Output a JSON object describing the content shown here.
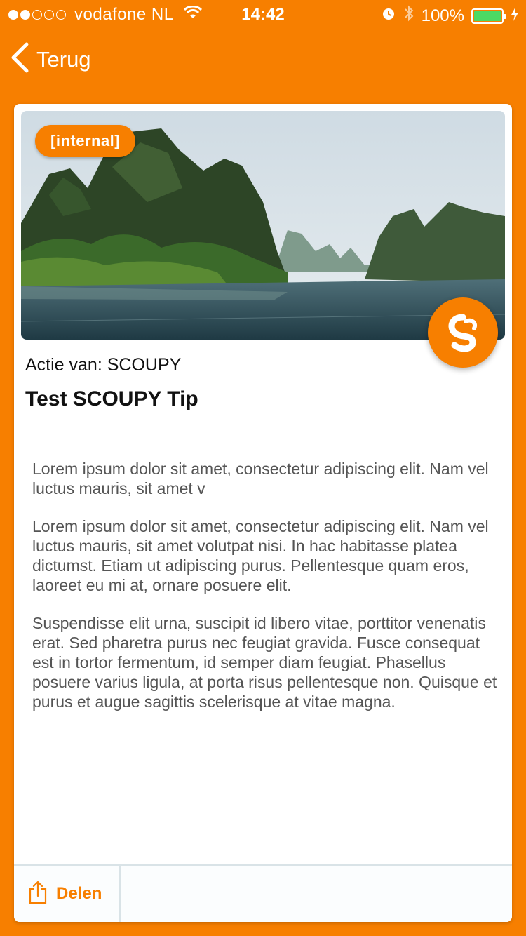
{
  "status_bar": {
    "carrier": "vodafone NL",
    "time": "14:42",
    "battery": "100%",
    "signal_bars_filled": 2,
    "signal_bars_total": 5
  },
  "nav": {
    "back_label": "Terug"
  },
  "card": {
    "badge": "[internal]",
    "byline": "Actie van: SCOUPY",
    "title": "Test SCOUPY Tip",
    "paragraphs": [
      "Lorem ipsum dolor sit amet, consectetur adipiscing elit. Nam vel luctus mauris, sit amet v",
      "Lorem ipsum dolor sit amet, consectetur adipiscing elit. Nam vel luctus mauris, sit amet volutpat nisi. In hac habitasse platea dictumst. Etiam ut adipiscing purus. Pellentesque quam eros, laoreet eu mi at, ornare posuere elit.",
      "Suspendisse elit urna, suscipit id libero vitae, porttitor venenatis erat. Sed pharetra purus nec feugiat gravida. Fusce consequat est in tortor fermentum, id semper diam feugiat. Phasellus posuere varius ligula, at porta risus pellentesque non. Quisque et purus et augue sagittis scelerisque at vitae magna."
    ],
    "share_label": "Delen"
  },
  "colors": {
    "brand_orange": "#F77F00",
    "battery_green": "#4CD964",
    "body_text": "#555555"
  },
  "icons": {
    "back": "chevron-left-icon",
    "share": "share-icon",
    "brand": "scoupy-logo-icon",
    "wifi": "wifi-icon",
    "alarm": "alarm-icon",
    "bluetooth": "bluetooth-icon",
    "charging": "charging-bolt-icon"
  }
}
